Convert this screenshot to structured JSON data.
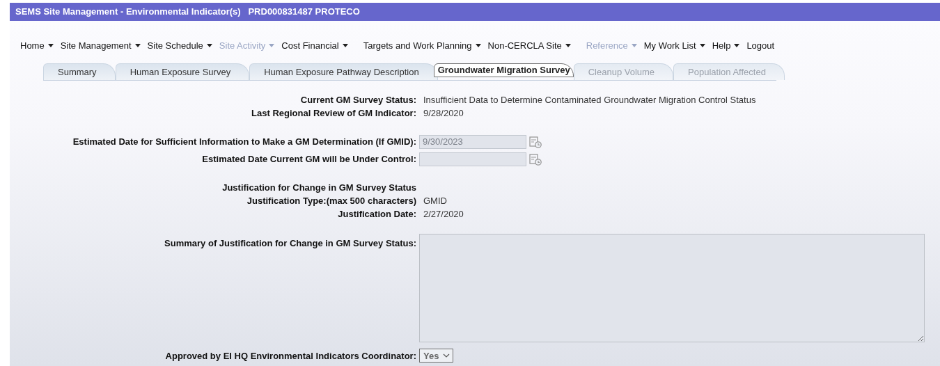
{
  "window": {
    "title": "SEMS Site Management - Environmental Indicator(s)   PRD000831487 PROTECO"
  },
  "menu": [
    {
      "label": "Home",
      "disabled": false,
      "caret": true
    },
    {
      "label": "Site Management",
      "disabled": false,
      "caret": true
    },
    {
      "label": "Site Schedule",
      "disabled": false,
      "caret": true
    },
    {
      "label": "Site Activity",
      "disabled": true,
      "caret": true
    },
    {
      "label": "Cost Financial",
      "disabled": false,
      "caret": true
    },
    {
      "label": "Targets and Work Planning",
      "disabled": false,
      "caret": true
    },
    {
      "label": "Non-CERCLA Site",
      "disabled": false,
      "caret": true
    },
    {
      "label": "Reference",
      "disabled": true,
      "caret": true
    },
    {
      "label": "My Work List",
      "disabled": false,
      "caret": true
    },
    {
      "label": "Help",
      "disabled": false,
      "caret": true
    },
    {
      "label": "Logout",
      "disabled": false,
      "caret": false
    }
  ],
  "tabs": [
    {
      "label": "Summary",
      "selected": false,
      "disabled": false
    },
    {
      "label": "Human Exposure Survey",
      "selected": false,
      "disabled": false
    },
    {
      "label": "Human Exposure Pathway Description",
      "selected": false,
      "disabled": false
    },
    {
      "label": "Groundwater Migration Survey",
      "selected": true,
      "disabled": false
    },
    {
      "label": "Cleanup Volume",
      "selected": false,
      "disabled": true
    },
    {
      "label": "Population Affected",
      "selected": false,
      "disabled": true
    }
  ],
  "form_groups": [
    [
      {
        "kind": "text",
        "label": "Current GM Survey Status:",
        "value": "Insufficient Data to Determine Contaminated Groundwater Migration Control Status"
      },
      {
        "kind": "text",
        "label": "Last Regional Review of GM Indicator:",
        "value": "9/28/2020"
      }
    ],
    [
      {
        "kind": "date",
        "label": "Estimated Date for Sufficient Information to Make a GM Determination (If GMID):",
        "value": "9/30/2023"
      },
      {
        "kind": "date",
        "label": "Estimated Date Current GM will be Under Control:"
      }
    ],
    [
      {
        "kind": "heading",
        "label": "Justification for Change in GM Survey Status"
      },
      {
        "kind": "text",
        "label": "Justification Type:(max 500 characters)",
        "value": "GMID"
      },
      {
        "kind": "text",
        "label": "Justification Date:",
        "value": "2/27/2020"
      }
    ],
    [
      {
        "kind": "textarea",
        "label": "Summary of Justification for Change in GM Survey Status:"
      },
      {
        "kind": "select",
        "label": "Approved by EI HQ Environmental Indicators Coordinator:",
        "value": "Yes"
      }
    ]
  ]
}
